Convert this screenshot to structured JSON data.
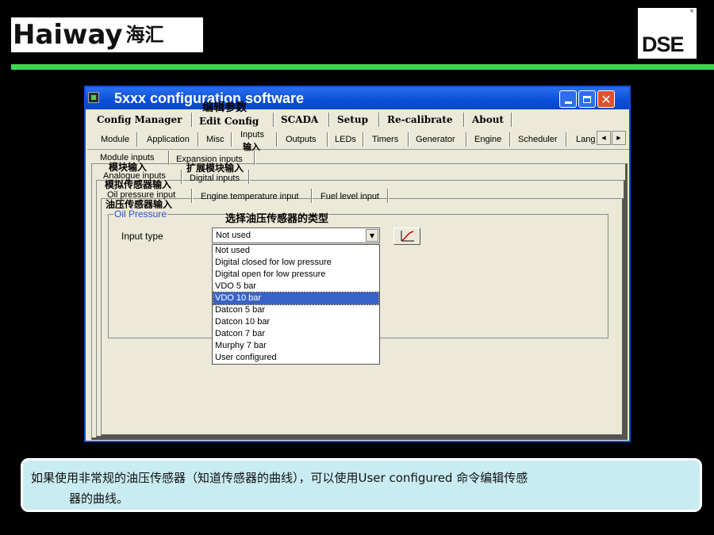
{
  "branding": {
    "haiway_en": "Haiway",
    "haiway_cn": "海汇",
    "dse": "DSE",
    "dse_mark": "®",
    "accent_color": "#3ed64e"
  },
  "window": {
    "title": "5xxx configuration software",
    "title_bar_color": "#0a4fd8",
    "controls": {
      "minimize": "minimize-icon",
      "maximize": "maximize-icon",
      "close": "✕"
    }
  },
  "menu": {
    "items": [
      "Config Manager",
      "Edit Config",
      "SCADA",
      "Setup",
      "Re-calibrate",
      "About"
    ],
    "edit_config_note": "编辑参数"
  },
  "config_tabs": {
    "items": [
      "Module",
      "Application",
      "Misc",
      "Inputs",
      "Outputs",
      "LEDs",
      "Timers",
      "Generator",
      "Engine",
      "Scheduler",
      "Lang"
    ],
    "inputs_note": "输入",
    "scroll_left": "◀",
    "scroll_right": "▶"
  },
  "input_tabs": {
    "module_inputs": "Module inputs",
    "module_inputs_note": "模块输入",
    "expansion_inputs": "Expansion inputs",
    "expansion_inputs_note": "扩展模块输入",
    "analogue_inputs": "Analogue inputs",
    "analogue_inputs_note": "模拟传感器输入",
    "digital_inputs": "Digital inputs"
  },
  "analogue_tabs": {
    "oil_pressure": "Oil pressure input",
    "oil_pressure_note": "油压传感器输入",
    "engine_temp": "Engine temperature input",
    "fuel_level": "Fuel level input"
  },
  "oil_pressure": {
    "group_title": "Oil Pressure",
    "select_note": "选择油压传感器的类型",
    "input_type_label": "Input type",
    "selected_value": "Not used",
    "dropdown_icon": "▼",
    "curve_icon": "curve-editor-icon",
    "options": [
      "Not used",
      "Digital closed for low pressure",
      "Digital open for low pressure",
      "VDO 5 bar",
      "VDO 10 bar",
      "Datcon 5 bar",
      "Datcon 10 bar",
      "Datcon 7 bar",
      "Murphy 7 bar",
      "User configured"
    ],
    "highlighted_option": "VDO 10 bar",
    "highlight_color": "#3a63c8"
  },
  "caption": {
    "line1": "如果使用非常规的油压传感器（知道传感器的曲线），可以使用User configured 命令编辑传感",
    "line2": "器的曲线。",
    "background": "#c8ecf2"
  }
}
